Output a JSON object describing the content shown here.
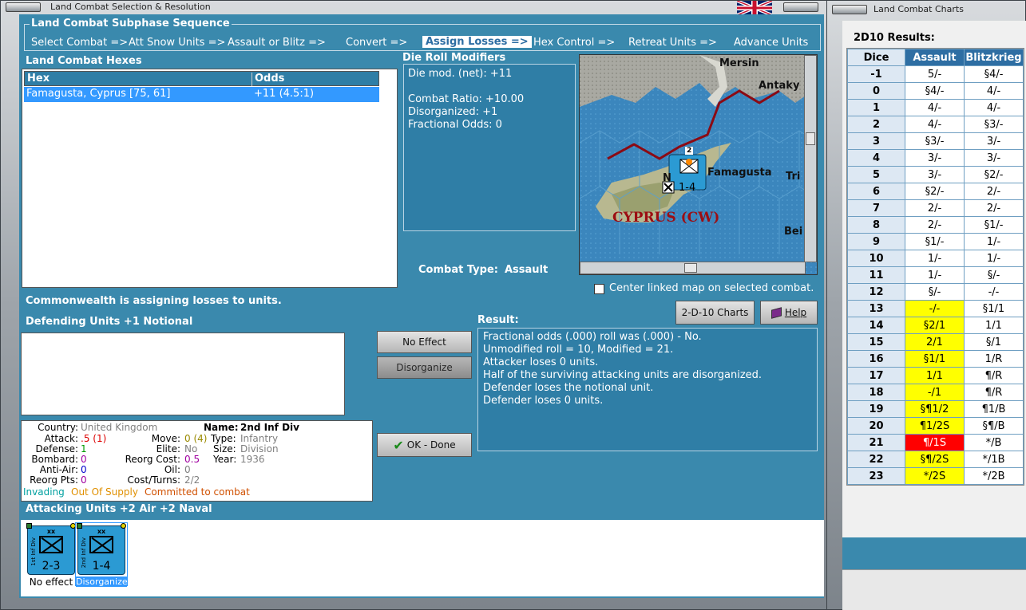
{
  "window_title": "Land Combat Selection & Resolution",
  "charts_window_title": "Land Combat Charts",
  "subphase": {
    "legend": "Land Combat Subphase Sequence",
    "steps": [
      "Select Combat =>",
      "Att Snow Units =>",
      "Assault or Blitz =>",
      "Convert =>",
      "Assign Losses =>",
      "Hex Control =>",
      "Retreat Units =>",
      "Advance Units"
    ],
    "active_index": 4
  },
  "hexes": {
    "title": "Land Combat Hexes",
    "col_hex": "Hex",
    "col_odds": "Odds",
    "rows": [
      {
        "hex": "Famagusta, Cyprus [75, 61]",
        "odds": "+11 (4.5:1)"
      }
    ]
  },
  "modifiers": {
    "title": "Die Roll Modifiers",
    "lines": [
      "Die mod. (net): +11",
      "",
      "Combat Ratio: +10.00",
      "Disorganized: +1",
      "Fractional Odds: 0"
    ]
  },
  "map": {
    "labels": {
      "mersin": "Mersin",
      "antakya": "Antaky",
      "famagusta": "Famagusta",
      "tri": "Tri",
      "bei": "Bei",
      "cyprus": "CYPRUS (CW)",
      "n": "N"
    },
    "unit_strength": "1-4",
    "unit_stack": "2",
    "unit_name": "2nd Inf Div"
  },
  "center_linked": "Center linked map on selected combat.",
  "combat_type": {
    "label": "Combat Type:",
    "value": "Assault"
  },
  "assigning": "Commonwealth is assigning losses to units.",
  "defending_title": "Defending Units +1 Notional",
  "buttons": {
    "no_effect": "No Effect",
    "disorganize": "Disorganize",
    "ok_done": "OK - Done",
    "charts": "2-D-10 Charts",
    "help": "Help"
  },
  "result": {
    "title": "Result:",
    "lines": [
      "Fractional odds (.000) roll was (.000)  - No.",
      "Unmodified roll = 10, Modified = 21.",
      "Attacker loses 0 units.",
      "Half of the surviving attacking units are disorganized.",
      "Defender loses the notional unit.",
      "Defender loses 0 units."
    ]
  },
  "unit_info": {
    "country_label": "Country:",
    "country": "United Kingdom",
    "name_label": "Name:",
    "name": "2nd Inf Div",
    "attack_label": "Attack:",
    "attack": ".5 (1)",
    "move_label": "Move:",
    "move": "0 (4)",
    "type_label": "Type:",
    "type": "Infantry",
    "defense_label": "Defense:",
    "defense": "1",
    "elite_label": "Elite:",
    "elite": "No",
    "size_label": "Size:",
    "size": "Division",
    "bombard_label": "Bombard:",
    "bombard": "0",
    "reorg_cost_label": "Reorg Cost:",
    "reorg_cost": "0.5",
    "year_label": "Year:",
    "year": "1936",
    "antiair_label": "Anti-Air:",
    "antiair": "0",
    "oil_label": "Oil:",
    "oil": "0",
    "reorg_pts_label": "Reorg Pts:",
    "reorg_pts": "0",
    "cost_turns_label": "Cost/Turns:",
    "cost_turns": "2/2",
    "status1": "Invading",
    "status2": "Out Of Supply",
    "status3": "Committed to combat"
  },
  "attacking": {
    "title": "Attacking Units +2 Air +2 Naval",
    "units": [
      {
        "side": "1st Inf Div",
        "strength": "2-3",
        "caption": "No effect"
      },
      {
        "side": "2nd Inf Div",
        "strength": "1-4",
        "caption": "Disorganized"
      }
    ]
  },
  "chart": {
    "title": "2D10 Results:",
    "headers": [
      "Dice",
      "Assault",
      "Blitzkrieg"
    ],
    "rows": [
      [
        "-1",
        "5/-",
        "§4/-"
      ],
      [
        "0",
        "§4/-",
        "4/-"
      ],
      [
        "1",
        "4/-",
        "4/-"
      ],
      [
        "2",
        "4/-",
        "§3/-"
      ],
      [
        "3",
        "§3/-",
        "3/-"
      ],
      [
        "4",
        "3/-",
        "3/-"
      ],
      [
        "5",
        "3/-",
        "§2/-"
      ],
      [
        "6",
        "§2/-",
        "2/-"
      ],
      [
        "7",
        "2/-",
        "2/-"
      ],
      [
        "8",
        "2/-",
        "§1/-"
      ],
      [
        "9",
        "§1/-",
        "1/-"
      ],
      [
        "10",
        "1/-",
        "1/-"
      ],
      [
        "11",
        "1/-",
        "§/-"
      ],
      [
        "12",
        "§/-",
        "-/-"
      ],
      [
        "13",
        "-/-",
        "§1/1"
      ],
      [
        "14",
        "§2/1",
        "1/1"
      ],
      [
        "15",
        "2/1",
        "§/1"
      ],
      [
        "16",
        "§1/1",
        "1/R"
      ],
      [
        "17",
        "1/1",
        "¶/R"
      ],
      [
        "18",
        "-/1",
        "¶/R"
      ],
      [
        "19",
        "§¶1/2",
        "¶1/B"
      ],
      [
        "20",
        "¶1/2S",
        "§¶/B"
      ],
      [
        "21",
        "¶/1S",
        "*/B"
      ],
      [
        "22",
        "§¶/2S",
        "*/1B"
      ],
      [
        "23",
        "*/2S",
        "*/2B"
      ]
    ],
    "highlight": {
      "13": "y",
      "14": "y",
      "15": "y",
      "16": "y",
      "17": "y",
      "18": "y",
      "19": "y",
      "20": "y",
      "21": "r",
      "22": "y",
      "23": "y"
    }
  },
  "colors": {
    "panel": "#3a89ad",
    "header": "#2e6ea3",
    "yellow": "#ffff00",
    "red": "#ff0000"
  }
}
